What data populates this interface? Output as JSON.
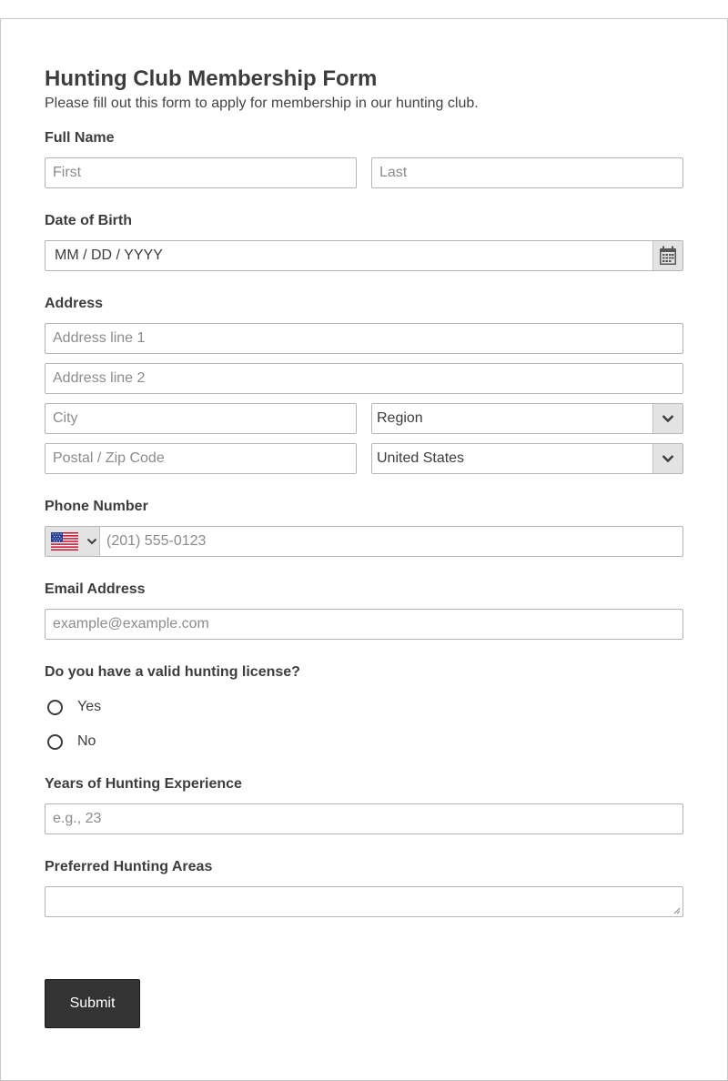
{
  "form": {
    "title": "Hunting Club Membership Form",
    "description": "Please fill out this form to apply for membership in our hunting club."
  },
  "full_name": {
    "label": "Full Name",
    "first_placeholder": "First",
    "last_placeholder": "Last"
  },
  "dob": {
    "label": "Date of Birth",
    "placeholder": "MM / DD / YYYY",
    "icon": "calendar-icon"
  },
  "address": {
    "label": "Address",
    "line1_placeholder": "Address line 1",
    "line2_placeholder": "Address line 2",
    "city_placeholder": "City",
    "region_value": "Region",
    "postal_placeholder": "Postal / Zip Code",
    "country_value": "United States"
  },
  "phone": {
    "label": "Phone Number",
    "placeholder": "(201) 555-0123",
    "flag_icon": "us-flag-icon"
  },
  "email": {
    "label": "Email Address",
    "placeholder": "example@example.com"
  },
  "license": {
    "question": "Do you have a valid hunting license?",
    "options": [
      "Yes",
      "No"
    ]
  },
  "experience": {
    "label": "Years of Hunting Experience",
    "placeholder": "e.g., 23"
  },
  "areas": {
    "label": "Preferred Hunting Areas"
  },
  "submit_label": "Submit",
  "colors": {
    "button_bg": "#333333",
    "border": "#b5b5b5",
    "select_button_bg": "#e3e3e3",
    "text": "#3d3d3d"
  }
}
